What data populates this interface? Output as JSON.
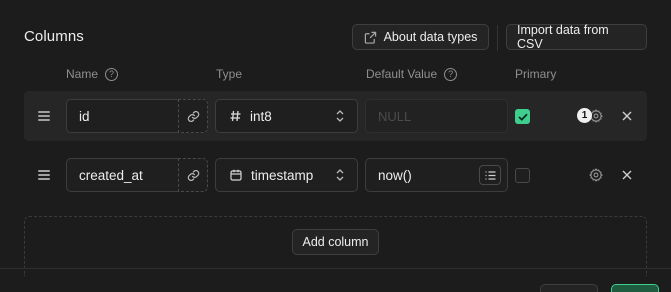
{
  "header": {
    "title": "Columns",
    "about_label": "About data types",
    "import_label": "Import data from CSV"
  },
  "columns_header": {
    "name": "Name",
    "type": "Type",
    "default": "Default Value",
    "primary": "Primary",
    "help_glyph": "?"
  },
  "rows": [
    {
      "name": "id",
      "type_icon": "hash-icon",
      "type": "int8",
      "default_placeholder": "NULL",
      "primary": true,
      "badge": "1"
    },
    {
      "name": "created_at",
      "type_icon": "calendar-icon",
      "type": "timestamp",
      "default_value": "now()",
      "primary": false
    }
  ],
  "add_column_label": "Add column",
  "colors": {
    "accent": "#3ecf8e",
    "background": "#1c1c1c"
  }
}
